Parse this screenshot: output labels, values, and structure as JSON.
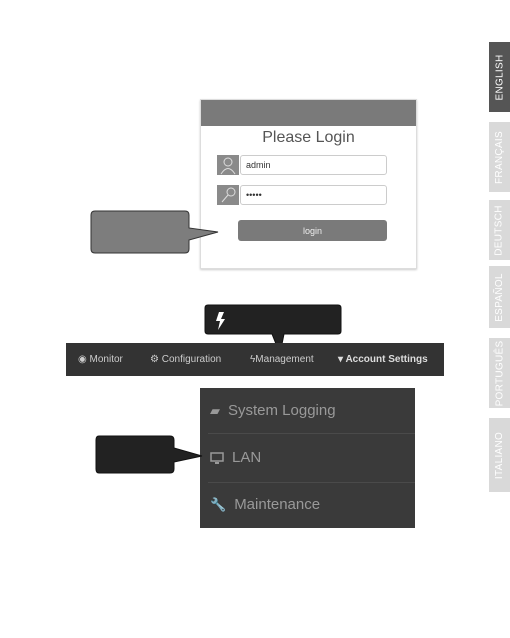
{
  "language_tabs": [
    {
      "label": "ENGLISH",
      "active": true
    },
    {
      "label": "FRANÇAIS",
      "active": false
    },
    {
      "label": "DEUTSCH",
      "active": false
    },
    {
      "label": "ESPAÑOL",
      "active": false
    },
    {
      "label": "PORTUGUÊS",
      "active": false
    },
    {
      "label": "ITALIANO",
      "active": false
    }
  ],
  "login": {
    "title": "Please Login",
    "username": "admin",
    "password": "•••••",
    "button": "login"
  },
  "nav": {
    "items": [
      "Monitor",
      "Configuration",
      "Management",
      "Account Settings"
    ]
  },
  "menu": {
    "items": [
      "System Logging",
      "LAN",
      "Maintenance"
    ]
  },
  "icons": {
    "user": "user-icon",
    "key": "key-icon",
    "monitor": "eye-icon",
    "configuration": "gears-icon",
    "management": "bolt-icon",
    "account": "caret-down-icon",
    "logging": "book-icon",
    "lan": "desktop-icon",
    "maintenance": "wrench-icon"
  }
}
